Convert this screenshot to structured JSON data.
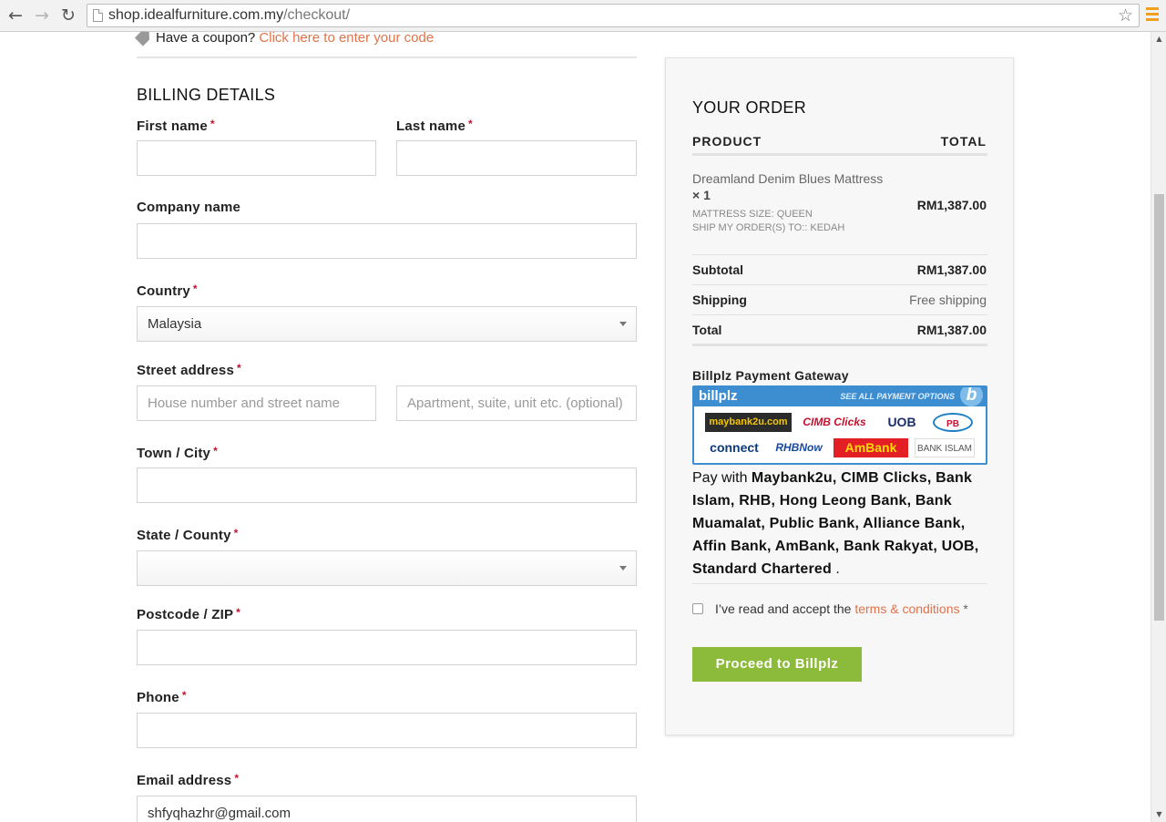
{
  "browser": {
    "url_host": "shop.idealfurniture.com.my",
    "url_path": "/checkout/"
  },
  "coupon": {
    "text": "Have a coupon?",
    "link": "Click here to enter your code"
  },
  "billing": {
    "title": "BILLING DETAILS",
    "first_name_label": "First name",
    "last_name_label": "Last name",
    "company_label": "Company name",
    "country_label": "Country",
    "country_value": "Malaysia",
    "street_label": "Street address",
    "street_placeholder": "House number and street name",
    "apt_placeholder": "Apartment, suite, unit etc. (optional)",
    "city_label": "Town / City",
    "state_label": "State / County",
    "state_value": "",
    "postcode_label": "Postcode / ZIP",
    "phone_label": "Phone",
    "email_label": "Email address",
    "email_value": "shfyqhazhr@gmail.com",
    "required_mark": "*"
  },
  "order": {
    "title": "YOUR ORDER",
    "col_product": "PRODUCT",
    "col_total": "TOTAL",
    "product_name": "Dreamland Denim Blues Mattress",
    "product_qty": "× 1",
    "meta_size": "MATTRESS SIZE:   QUEEN",
    "meta_ship": "SHIP MY ORDER(S) TO::   KEDAH",
    "product_total": "RM1,387.00",
    "subtotal_label": "Subtotal",
    "subtotal_value": "RM1,387.00",
    "shipping_label": "Shipping",
    "shipping_value": "Free shipping",
    "total_label": "Total",
    "total_value": "RM1,387.00"
  },
  "payment": {
    "gateway_title": "Billplz Payment Gateway",
    "banner_logo": "billplz",
    "banner_see_all": "SEE ALL PAYMENT OPTIONS",
    "banner_b": "b",
    "banks": [
      "maybank2u.com",
      "CIMB Clicks",
      "UOB",
      "PB",
      "connect",
      "RHBNow",
      "AmBank",
      "BANK ISLAM"
    ],
    "pay_with_prefix": "Pay with",
    "pay_with_banks": "Maybank2u, CIMB Clicks, Bank Islam, RHB, Hong Leong Bank, Bank Muamalat, Public Bank, Alliance Bank, Affin Bank, AmBank, Bank Rakyat, UOB, Standard Chartered",
    "pay_with_suffix": ".",
    "terms_text": "I’ve read and accept the",
    "terms_link": "terms & conditions",
    "terms_req": "*",
    "proceed_label": "Proceed to Billplz"
  },
  "colors": {
    "accent_link": "#e0734a",
    "button_green": "#8cba3a",
    "billplz_blue": "#3d8ed0"
  }
}
